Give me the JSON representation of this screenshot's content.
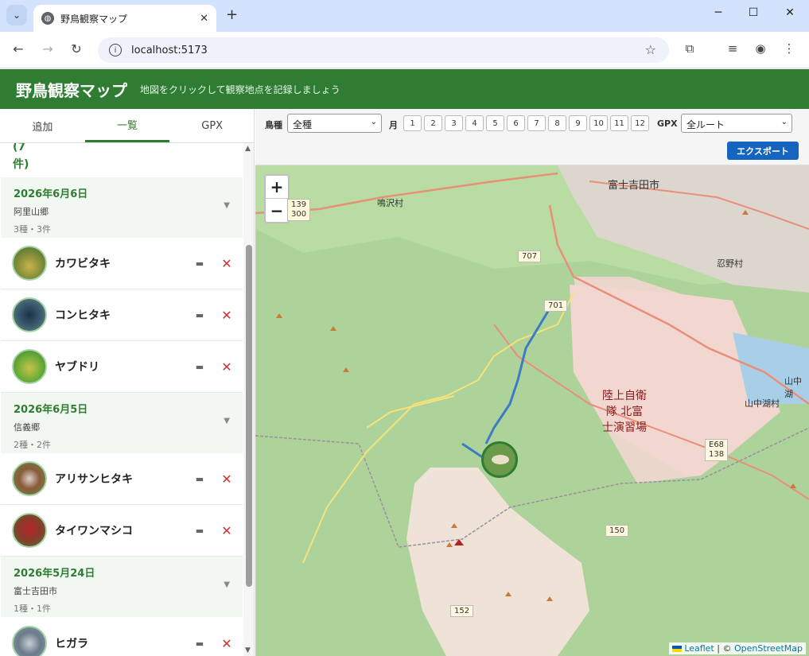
{
  "browser": {
    "tab_title": "野鳥観察マップ",
    "url": "localhost:5173",
    "new_tab": "+",
    "close_tab": "✕"
  },
  "app": {
    "title": "野鳥観察マップ",
    "subtitle": "地図をクリックして観察地点を記録しましょう"
  },
  "sidebar": {
    "tabs": [
      {
        "label": "追加"
      },
      {
        "label": "一覧"
      },
      {
        "label": "GPX"
      }
    ],
    "count_label": "(7\n件)",
    "groups": [
      {
        "date": "2026年6月6日",
        "place": "阿里山郷",
        "counts": "3種・3件",
        "items": [
          {
            "name": "カワビタキ"
          },
          {
            "name": "コンヒタキ"
          },
          {
            "name": "ヤブドリ"
          }
        ]
      },
      {
        "date": "2026年6月5日",
        "place": "信義郷",
        "counts": "2種・2件",
        "items": [
          {
            "name": "アリサンヒタキ"
          },
          {
            "name": "タイワンマシコ"
          }
        ]
      },
      {
        "date": "2026年5月24日",
        "place": "富士吉田市",
        "counts": "1種・1件",
        "items": [
          {
            "name": "ヒガラ"
          }
        ]
      }
    ]
  },
  "filters": {
    "species_label": "鳥種",
    "species_value": "全種",
    "month_label": "月",
    "months": [
      "1",
      "2",
      "3",
      "4",
      "5",
      "6",
      "7",
      "8",
      "9",
      "10",
      "11",
      "12"
    ],
    "gpx_label": "GPX",
    "gpx_value": "全ルート",
    "export_label": "エクスポート"
  },
  "map": {
    "zoom_in": "+",
    "zoom_out": "−",
    "city_label": "富士吉田市",
    "labels": {
      "narusawa": "鳴沢村",
      "oshino": "忍野村",
      "yamanakako": "山中湖村",
      "yamanakako_lake": "山中湖",
      "base": "陸上自衛\n隊 北富\n士演習場"
    },
    "route_shields": [
      "139\n300",
      "707",
      "701",
      "E68\n138",
      "150",
      "152"
    ],
    "attribution_leaflet": "Leaflet",
    "attribution_sep": " | © ",
    "attribution_osm": "OpenStreetMap",
    "colors": {
      "land": "#aed39a",
      "base_area": "#f2d6d0",
      "bare": "#efe2d6",
      "track": "#3b7dc4"
    }
  }
}
